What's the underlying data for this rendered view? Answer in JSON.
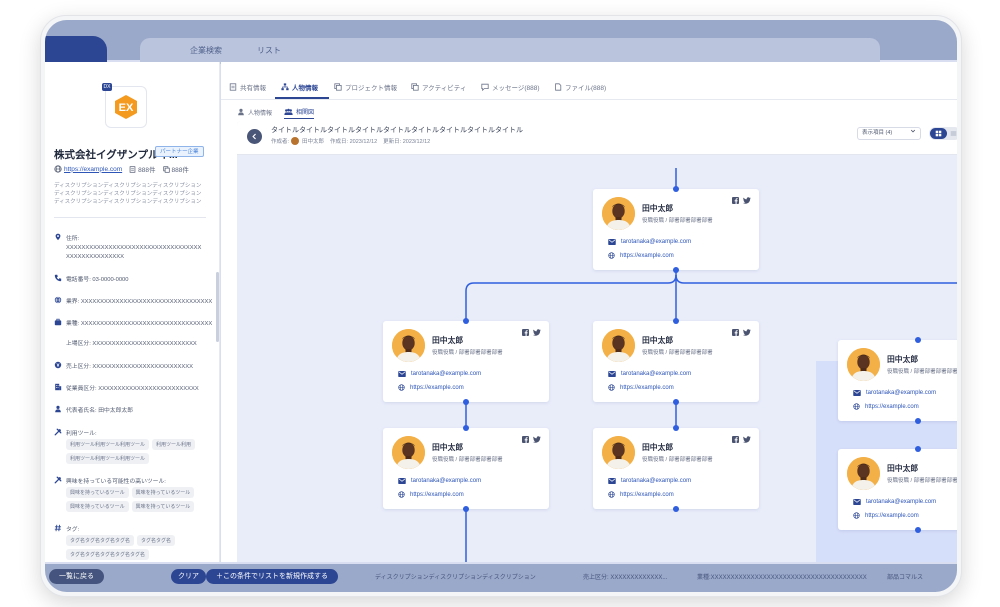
{
  "background": {
    "tabs": [
      "企業検索",
      "リスト"
    ],
    "clear_button": "クリア",
    "create_button": "＋この条件でリストを新規作成する",
    "back_button": "一覧に戻る",
    "bottom_texts": [
      "ディスクリプションディスクリプションディスクリプション",
      "売上区分: XXXXXXXXXXXXX...",
      "業種:XXXXXXXXXXXXXXXXXXXXXXXXXXXXXXXXXXXXXXX",
      "部品コマルス"
    ]
  },
  "company": {
    "logo_badge": "DX",
    "name": "株式会社イグザンプルイ...",
    "partner_badge": "パートナー企業",
    "url": "https://example.com",
    "count1": "888件",
    "count2": "888件",
    "description": "ディスクリプションディスクリプションディスクリプションディスクリプションディスクリプションディスクリプションディスクリプションディスクリプションディスクリプション",
    "address_label": "住所:",
    "address_value": "XXXXXXXXXXXXXXXXXXXXXXXXXXXXXXXXXXXXXXXXXXXXXXXXXX",
    "phone": "電話番号: 03-0000-0000",
    "industry1": "業界: XXXXXXXXXXXXXXXXXXXXXXXXXXXXXXXXXX",
    "industry2": "業種: XXXXXXXXXXXXXXXXXXXXXXXXXXXXXXXXXX",
    "listing": "上場区分: XXXXXXXXXXXXXXXXXXXXXXXXXXX",
    "sales": "売上区分: XXXXXXXXXXXXXXXXXXXXXXXXXX",
    "employees": "従業員区分: XXXXXXXXXXXXXXXXXXXXXXXXXX",
    "ceo": "代表者氏名: 田中太郎太郎",
    "tools_label": "利用ツール:",
    "tools": [
      "利用ツール利用ツール利用ツール",
      "利用ツール利用",
      "利用ツール利用ツール利用ツール"
    ],
    "interest_label": "興味を持っている可能性の高いツール:",
    "interest": [
      "興味を持っているツール",
      "興味を持っているツール",
      "興味を持っているツール",
      "興味を持っているツール"
    ],
    "tags_label": "タグ:",
    "tags": [
      "タグ名タグ名タグ名タグ名",
      "タグ名タグ名",
      "タグ名タグ名タグ名タグ名タグ名"
    ]
  },
  "tabs": [
    "共有情報",
    "人物情報",
    "プロジェクト情報",
    "アクティビティ",
    "メッセージ(888)",
    "ファイル(888)"
  ],
  "subtabs": [
    "人物情報",
    "相関図"
  ],
  "chart_header": {
    "title": "タイトルタイトルタイトルタイトルタイトルタイトルタイトルタイトルタイトル",
    "creator_label": "作成者:",
    "creator": "田中太郎",
    "created": "作成日: 2023/12/12",
    "updated": "更新日: 2023/12/12",
    "display_select": "表示項目 (4)"
  },
  "person": {
    "name": "田中太郎",
    "role": "役職役職 / 部署部署部署部署",
    "email": "tarotanaka@example.com",
    "url": "https://example.com"
  }
}
